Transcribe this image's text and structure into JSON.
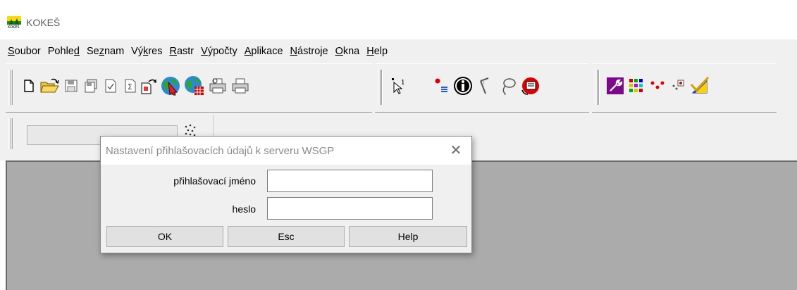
{
  "window": {
    "title": "KOKEŠ",
    "icon": "kokes-app-icon"
  },
  "menu": [
    {
      "pre": "",
      "u": "S",
      "post": "oubor"
    },
    {
      "pre": "Pohle",
      "u": "d",
      "post": ""
    },
    {
      "pre": "Se",
      "u": "z",
      "post": "nam"
    },
    {
      "pre": "Vý",
      "u": "k",
      "post": "res"
    },
    {
      "pre": "",
      "u": "R",
      "post": "astr"
    },
    {
      "pre": "",
      "u": "V",
      "post": "ýpočty"
    },
    {
      "pre": "",
      "u": "A",
      "post": "plikace"
    },
    {
      "pre": "",
      "u": "N",
      "post": "ástroje"
    },
    {
      "pre": "",
      "u": "O",
      "post": "kna"
    },
    {
      "pre": "",
      "u": "H",
      "post": "elp"
    }
  ],
  "toolbar_main": [
    "new-document-icon",
    "open-folder-icon",
    "save-disk-icon",
    "save-all-icon",
    "check-document-icon",
    "sum-document-icon",
    "export-document-icon",
    "globe-arrow-icon",
    "globe-grid-icon",
    "print-preview-icon",
    "printer-icon"
  ],
  "toolbar_tools": [
    "select-info-cursor-icon",
    "point-list-icon",
    "info-icon",
    "measure-angle-icon",
    "lasso-icon",
    "layer-refresh-icon"
  ],
  "toolbar_apps": [
    "settings-wrench-icon",
    "color-grid-icon",
    "points-red-icon",
    "points-frame-icon",
    "check-triangle-icon"
  ],
  "colors": {
    "accent": "#0078d7",
    "workspace": "#ababab",
    "chrome": "#f0f0f0"
  },
  "dialog": {
    "title": "Nastavení přihlašovacích údajů k serveru WSGP",
    "close_glyph": "✕",
    "username_label": "přihlašovací jméno",
    "password_label": "heslo",
    "username_value": "",
    "password_value": "",
    "ok_label": "OK",
    "esc_label": "Esc",
    "help_label": "Help"
  }
}
